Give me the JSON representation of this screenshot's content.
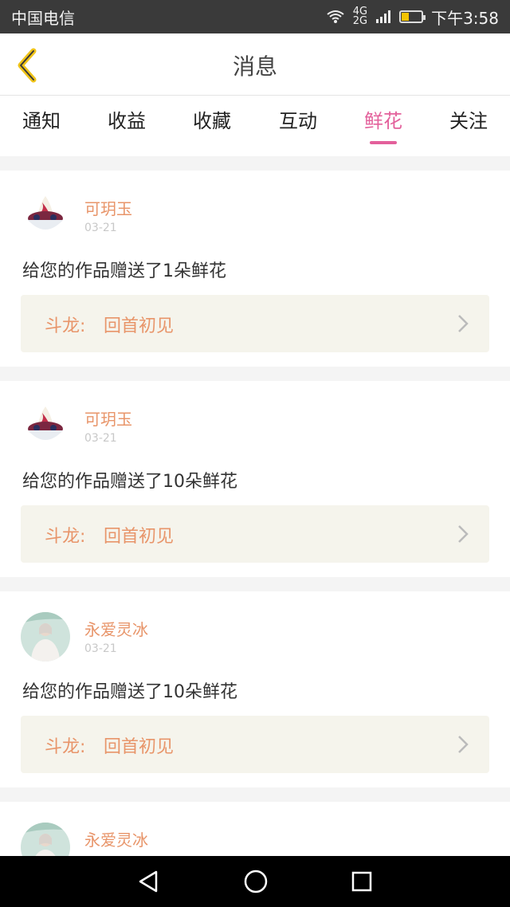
{
  "status": {
    "carrier": "中国电信",
    "network": "4G",
    "network2": "2G",
    "time": "下午3:58"
  },
  "header": {
    "title": "消息"
  },
  "tabs": [
    {
      "label": "通知"
    },
    {
      "label": "收益"
    },
    {
      "label": "收藏"
    },
    {
      "label": "互动"
    },
    {
      "label": "鲜花",
      "active": true
    },
    {
      "label": "关注"
    }
  ],
  "messages": [
    {
      "user": "可玥玉",
      "date": "03-21",
      "text": "给您的作品赠送了1朵鲜花",
      "work_label": "斗龙:",
      "work_title": "回首初见",
      "avatar": "ice-cream"
    },
    {
      "user": "可玥玉",
      "date": "03-21",
      "text": "给您的作品赠送了10朵鲜花",
      "work_label": "斗龙:",
      "work_title": "回首初见",
      "avatar": "ice-cream"
    },
    {
      "user": "永爱灵冰",
      "date": "03-21",
      "text": "给您的作品赠送了10朵鲜花",
      "work_label": "斗龙:",
      "work_title": "回首初见",
      "avatar": "girl"
    },
    {
      "user": "永爱灵冰",
      "date": "03-21",
      "text": "",
      "work_label": "",
      "work_title": "",
      "avatar": "girl"
    }
  ],
  "colors": {
    "accent": "#e3609b",
    "name": "#e8956a",
    "back_arrow": "#f0c419"
  }
}
